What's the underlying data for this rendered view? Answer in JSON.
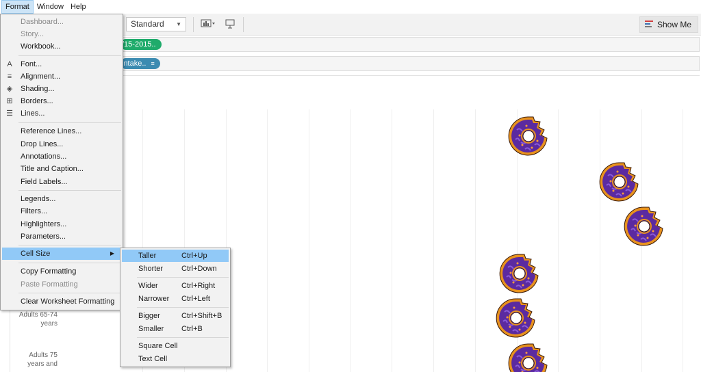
{
  "menubar": {
    "items": [
      "Format",
      "Window",
      "Help"
    ]
  },
  "toolbar": {
    "fit_value": "Standard",
    "show_me_label": "Show Me"
  },
  "shelves": {
    "columns_pill": "/15-2015..",
    "rows_pill": "intake.."
  },
  "view": {
    "row_headers": [
      {
        "line1": "Adults 65-74",
        "line2": "years"
      },
      {
        "line1": "Adults 75",
        "line2": "years and"
      }
    ]
  },
  "format_menu": {
    "items": [
      {
        "label": "Dashboard...",
        "disabled": true,
        "icon": ""
      },
      {
        "label": "Story...",
        "disabled": true,
        "icon": ""
      },
      {
        "label": "Workbook...",
        "disabled": false,
        "icon": ""
      },
      {
        "label": "Font...",
        "disabled": false,
        "icon": "font-icon",
        "glyph": "A"
      },
      {
        "label": "Alignment...",
        "disabled": false,
        "icon": "alignment-icon",
        "glyph": "≡"
      },
      {
        "label": "Shading...",
        "disabled": false,
        "icon": "shading-icon",
        "glyph": "◈"
      },
      {
        "label": "Borders...",
        "disabled": false,
        "icon": "borders-icon",
        "glyph": "⊞"
      },
      {
        "label": "Lines...",
        "disabled": false,
        "icon": "lines-icon",
        "glyph": "☰"
      },
      {
        "label": "Reference Lines...",
        "disabled": false,
        "icon": ""
      },
      {
        "label": "Drop Lines...",
        "disabled": false,
        "icon": ""
      },
      {
        "label": "Annotations...",
        "disabled": false,
        "icon": ""
      },
      {
        "label": "Title and Caption...",
        "disabled": false,
        "icon": ""
      },
      {
        "label": "Field Labels...",
        "disabled": false,
        "icon": ""
      },
      {
        "label": "Legends...",
        "disabled": false,
        "icon": ""
      },
      {
        "label": "Filters...",
        "disabled": false,
        "icon": ""
      },
      {
        "label": "Highlighters...",
        "disabled": false,
        "icon": ""
      },
      {
        "label": "Parameters...",
        "disabled": false,
        "icon": ""
      },
      {
        "label": "Cell Size",
        "disabled": false,
        "icon": "",
        "submenu": true,
        "highlighted": true
      },
      {
        "label": "Copy Formatting",
        "disabled": false,
        "icon": ""
      },
      {
        "label": "Paste Formatting",
        "disabled": true,
        "icon": ""
      },
      {
        "label": "Clear Worksheet Formatting",
        "disabled": false,
        "icon": ""
      }
    ]
  },
  "cell_size_submenu": {
    "items": [
      {
        "label": "Taller",
        "shortcut": "Ctrl+Up",
        "highlighted": true
      },
      {
        "label": "Shorter",
        "shortcut": "Ctrl+Down"
      },
      {
        "label": "Wider",
        "shortcut": "Ctrl+Right"
      },
      {
        "label": "Narrower",
        "shortcut": "Ctrl+Left"
      },
      {
        "label": "Bigger",
        "shortcut": "Ctrl+Shift+B"
      },
      {
        "label": "Smaller",
        "shortcut": "Ctrl+B"
      },
      {
        "label": "Square Cell",
        "shortcut": ""
      },
      {
        "label": "Text Cell",
        "shortcut": ""
      }
    ]
  },
  "colors": {
    "menu_highlight": "#91c9f7",
    "pill_green": "#1fab6b",
    "pill_blue": "#3c8bb1",
    "donut_icing": "#5b2aa0",
    "donut_dough": "#e8921e"
  }
}
